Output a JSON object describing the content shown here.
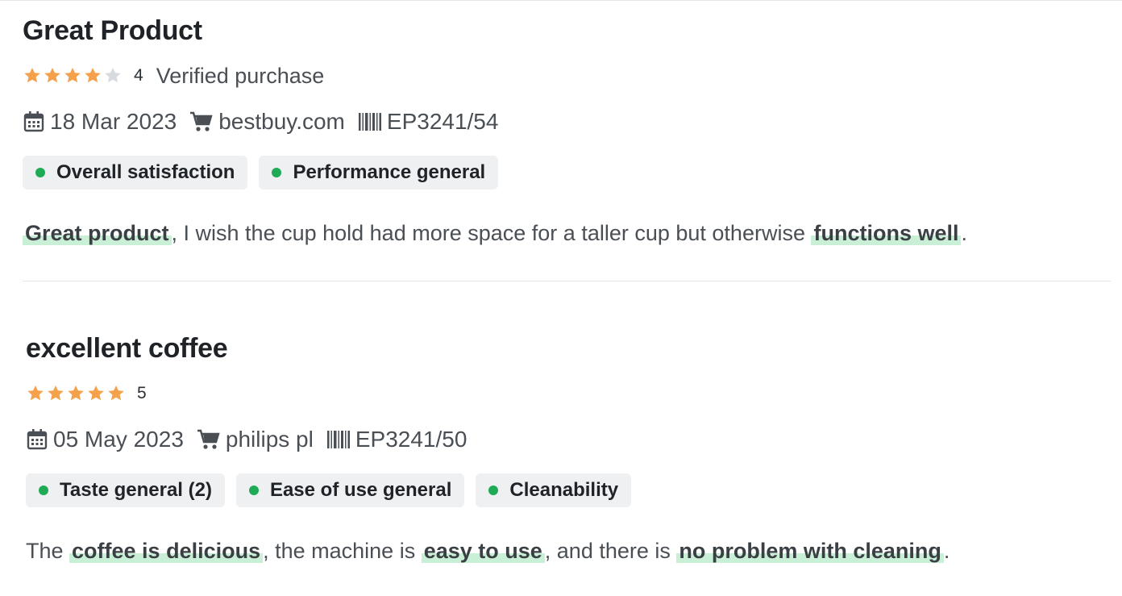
{
  "colors": {
    "star_filled": "#f5a04a",
    "star_empty": "#d7dbe0",
    "dot": "#1faa56",
    "highlight": "#c9f0d6"
  },
  "reviews": [
    {
      "title": "Great Product",
      "rating": 4,
      "rating_label": "4",
      "verified": "Verified purchase",
      "date": "18 Mar 2023",
      "store": "bestbuy.com",
      "model": "EP3241/54",
      "tags": [
        "Overall satisfaction",
        "Performance general"
      ],
      "text": {
        "h1": "Great product",
        "t1": ", I wish the cup hold had more space for a taller cup but otherwise ",
        "h2": "functions well",
        "t2": "."
      }
    },
    {
      "title": "excellent coffee",
      "rating": 5,
      "rating_label": "5",
      "date": "05 May 2023",
      "store": "philips pl",
      "model": "EP3241/50",
      "tags": [
        "Taste general (2)",
        "Ease of use general",
        "Cleanability"
      ],
      "text": {
        "t0": "The ",
        "h1": "coffee is delicious",
        "t1": ", the machine is ",
        "h2": "easy to use",
        "t2": ", and there is ",
        "h3": "no problem with cleaning",
        "t3": "."
      }
    }
  ]
}
